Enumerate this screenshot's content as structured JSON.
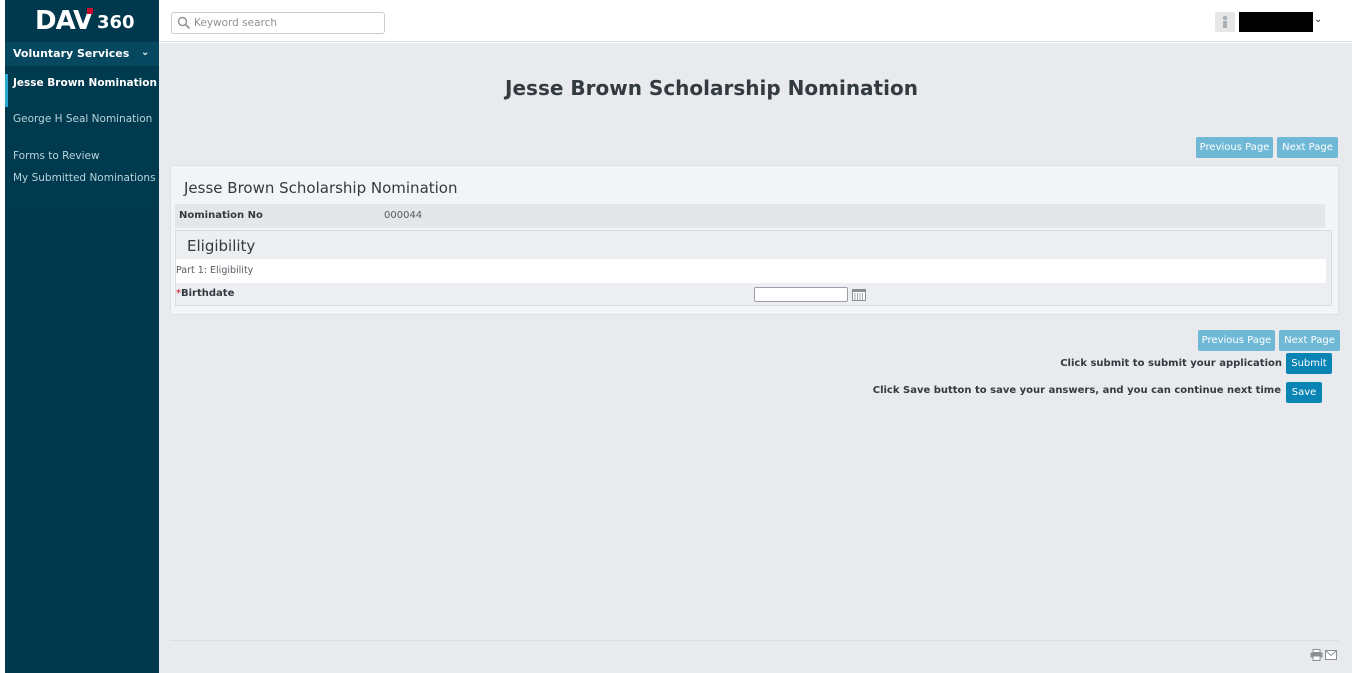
{
  "logo": {
    "brand": "DAV",
    "suffix": "360"
  },
  "sidebar": {
    "section": "Voluntary Services",
    "items": [
      {
        "label": "Jesse Brown Nomination",
        "active": true
      },
      {
        "label": "George H Seal Nomination",
        "active": false
      },
      {
        "label": "Forms to Review",
        "active": false
      },
      {
        "label": "My Submitted Nominations",
        "active": false
      }
    ]
  },
  "search": {
    "placeholder": "Keyword search",
    "value": ""
  },
  "page": {
    "title": "Jesse Brown Scholarship Nomination"
  },
  "pagination": {
    "previous_label": "Previous Page",
    "next_label": "Next Page"
  },
  "form": {
    "title": "Jesse Brown Scholarship Nomination",
    "nomination_label": "Nomination No",
    "nomination_value": "000044",
    "section_title": "Eligibility",
    "part_label": "Part 1: Eligibility",
    "birthdate_label": "Birthdate",
    "birthdate_value": "",
    "required_marker": "*"
  },
  "actions": {
    "submit_message": "Click submit to submit your application",
    "submit_label": "Submit",
    "save_message": "Click Save button to save your answers, and you can continue next time",
    "save_label": "Save"
  },
  "colors": {
    "sidebar": "#00384d",
    "accent": "#0a83b5",
    "nav_button": "#6fb9d6",
    "background": "#e8eaee"
  }
}
